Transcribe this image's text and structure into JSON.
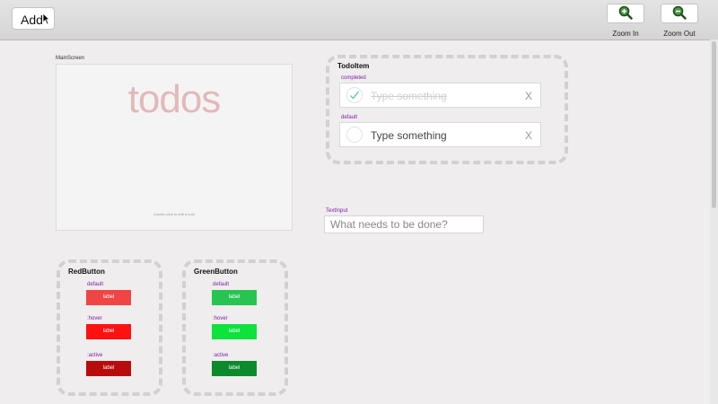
{
  "toolbar": {
    "add_label": "Add",
    "zoom_in_label": "Zoom In",
    "zoom_out_label": "Zoom Out"
  },
  "main_screen": {
    "label": "MainScreen",
    "title": "todos",
    "hint": "Double-click to edit a todo"
  },
  "todo_item": {
    "title": "TodoItem",
    "completed": {
      "state": "completed",
      "text": "Type something",
      "delete": "X"
    },
    "default": {
      "state": "default",
      "text": "Type something",
      "delete": "X"
    }
  },
  "text_input": {
    "label": "TextInput",
    "placeholder": "What needs to be done?"
  },
  "red_button": {
    "title": "RedButton",
    "states": [
      {
        "state": "default",
        "label": "label",
        "color": "#f04545"
      },
      {
        "state": ":hover",
        "label": "label",
        "color": "#ff1111"
      },
      {
        "state": ":active",
        "label": "label",
        "color": "#b80c0c"
      }
    ]
  },
  "green_button": {
    "title": "GreenButton",
    "states": [
      {
        "state": "default",
        "label": "label",
        "color": "#28c452"
      },
      {
        "state": ":hover",
        "label": "label",
        "color": "#0ee23d"
      },
      {
        "state": ":active",
        "label": "label",
        "color": "#0c8a2c"
      }
    ]
  },
  "colors": {
    "state_label": "#7a1fa2",
    "todos_title": "#e2b9b9"
  }
}
